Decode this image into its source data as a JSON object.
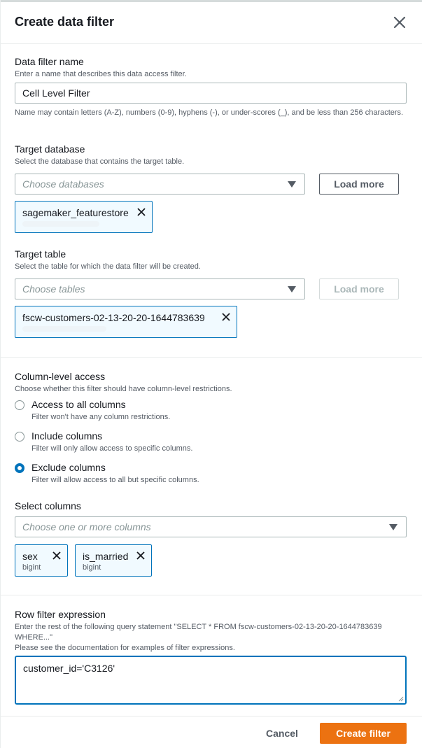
{
  "header": {
    "title": "Create data filter"
  },
  "filter_name": {
    "label": "Data filter name",
    "description": "Enter a name that describes this data access filter.",
    "value": "Cell Level Filter",
    "hint": "Name may contain letters (A-Z), numbers (0-9), hyphens (-), or under-scores (_), and be less than 256 characters."
  },
  "target_database": {
    "label": "Target database",
    "description": "Select the database that contains the target table.",
    "placeholder": "Choose databases",
    "load_more": "Load more",
    "selected": [
      {
        "name": "sagemaker_featurestore"
      }
    ]
  },
  "target_table": {
    "label": "Target table",
    "description": "Select the table for which the data filter will be created.",
    "placeholder": "Choose tables",
    "load_more": "Load more",
    "selected": [
      {
        "name": "fscw-customers-02-13-20-20-1644783639"
      }
    ]
  },
  "column_access": {
    "label": "Column-level access",
    "description": "Choose whether this filter should have column-level restrictions.",
    "options": [
      {
        "label": "Access to all columns",
        "description": "Filter won't have any column restrictions.",
        "checked": false
      },
      {
        "label": "Include columns",
        "description": "Filter will only allow access to specific columns.",
        "checked": false
      },
      {
        "label": "Exclude columns",
        "description": "Filter will allow access to all but specific columns.",
        "checked": true
      }
    ]
  },
  "select_columns": {
    "label": "Select columns",
    "placeholder": "Choose one or more columns",
    "selected": [
      {
        "name": "sex",
        "type": "bigint"
      },
      {
        "name": "is_married",
        "type": "bigint"
      }
    ]
  },
  "row_filter": {
    "label": "Row filter expression",
    "description_1": "Enter the rest of the following query statement \"SELECT * FROM fscw-customers-02-13-20-20-1644783639 WHERE...\"",
    "description_2": "Please see the documentation for examples of filter expressions.",
    "value": "customer_id='C3126'"
  },
  "footer": {
    "cancel": "Cancel",
    "create": "Create filter"
  },
  "colors": {
    "accent": "#0073bb",
    "primary_button": "#ec7211"
  }
}
